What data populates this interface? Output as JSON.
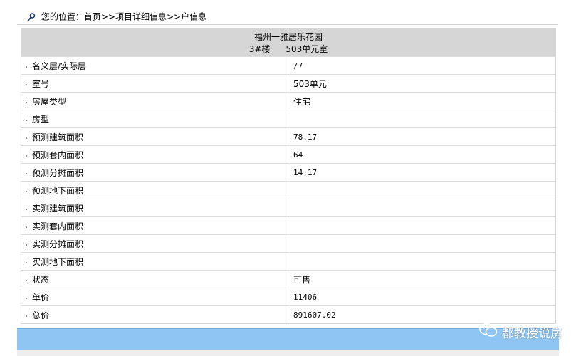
{
  "breadcrumb": {
    "prefix": "您的位置：",
    "home": "首页",
    "sep1": ">>",
    "project": "项目详细信息",
    "sep2": ">>",
    "current": "户信息"
  },
  "header": {
    "project_name": "福州一雅居乐花园",
    "building": "3#楼",
    "room": "503单元室"
  },
  "rows": [
    {
      "label": "名义层/实际层",
      "value": "/7"
    },
    {
      "label": "室号",
      "value": "503单元"
    },
    {
      "label": "房屋类型",
      "value": "住宅"
    },
    {
      "label": "房型",
      "value": ""
    },
    {
      "label": "预测建筑面积",
      "value": "78.17"
    },
    {
      "label": "预测套内面积",
      "value": "64"
    },
    {
      "label": "预测分摊面积",
      "value": "14.17"
    },
    {
      "label": "预测地下面积",
      "value": ""
    },
    {
      "label": "实测建筑面积",
      "value": ""
    },
    {
      "label": "实测套内面积",
      "value": ""
    },
    {
      "label": "实测分摊面积",
      "value": ""
    },
    {
      "label": "实测地下面积",
      "value": ""
    },
    {
      "label": "状态",
      "value": "可售"
    },
    {
      "label": "单价",
      "value": "11406"
    },
    {
      "label": "总价",
      "value": "891607.02"
    }
  ],
  "row_marker": "›",
  "watermark": {
    "text": "都教授说房",
    "icon": "wechat-icon"
  },
  "colors": {
    "header_bg": "#d6d6d6",
    "bottom_bar": "#8ec5f2"
  }
}
